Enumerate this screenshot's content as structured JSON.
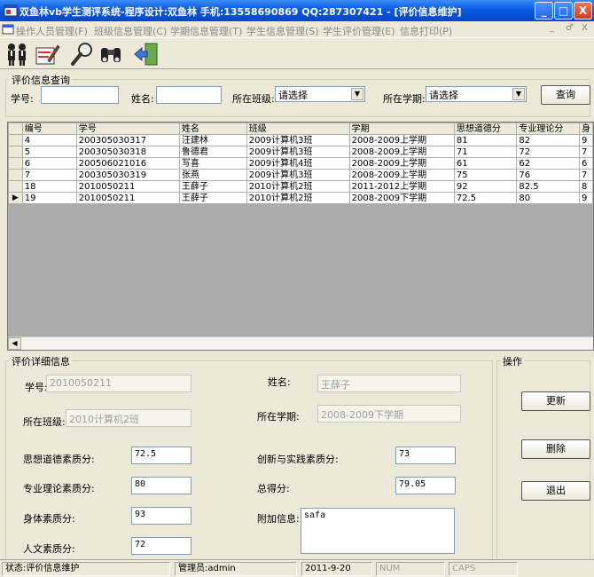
{
  "window": {
    "title": "双鱼林vb学生测评系统-程序设计:双鱼林 手机:13558690869 QQ:287307421 - [评价信息维护]",
    "minimize": "_",
    "maximize": "□",
    "close": "X"
  },
  "menu": {
    "items": [
      "操作人员管理(F)",
      "班级信息管理(C)",
      "学期信息管理(T)",
      "学生信息管理(S)",
      "学生评价管理(E)",
      "信息打印(P)"
    ],
    "mdi_controls": [
      "_",
      "♂",
      "X"
    ]
  },
  "toolbar": {
    "buttons": [
      "users-icon",
      "edit-icon",
      "search-icon",
      "binoculars-icon",
      "exit-icon"
    ]
  },
  "query": {
    "title": "评价信息查询",
    "student_no_label": "学号:",
    "student_no_value": "",
    "name_label": "姓名:",
    "name_value": "",
    "class_label": "所在班级:",
    "class_value": "请选择",
    "term_label": "所在学期:",
    "term_value": "请选择",
    "search_button": "查询"
  },
  "grid": {
    "columns": [
      "编号",
      "学号",
      "姓名",
      "班级",
      "学期",
      "思想道德分",
      "专业理论分",
      "身"
    ],
    "rows": [
      [
        "4",
        "200305030317",
        "汪建林",
        "2009计算机3班",
        "2008-2009上学期",
        "81",
        "82",
        "9"
      ],
      [
        "5",
        "200305030318",
        "鲁德君",
        "2009计算机3班",
        "2008-2009上学期",
        "71",
        "72",
        "7"
      ],
      [
        "6",
        "200506021016",
        "写喜",
        "2009计算机4班",
        "2008-2009上学期",
        "61",
        "62",
        "6"
      ],
      [
        "7",
        "200305030319",
        "张燕",
        "2009计算机3班",
        "2008-2009上学期",
        "75",
        "76",
        "7"
      ],
      [
        "18",
        "2010050211",
        "王薛子",
        "2010计算机2班",
        "2011-2012上学期",
        "92",
        "82.5",
        "8"
      ],
      [
        "19",
        "2010050211",
        "王薛子",
        "2010计算机2班",
        "2008-2009下学期",
        "72.5",
        "80",
        "9"
      ]
    ],
    "current_row_index": 5,
    "current_row_marker": "▶",
    "scroll_left_arrow": "◀"
  },
  "detail": {
    "title": "评价详细信息",
    "student_no_label": "学号:",
    "student_no_value": "2010050211",
    "name_label": "姓名:",
    "name_value": "王薛子",
    "class_label": "所在班级:",
    "class_value": "2010计算机2班",
    "term_label": "所在学期:",
    "term_value": "2008-2009下学期",
    "moral_label": "思想道德素质分:",
    "moral_value": "72.5",
    "innovation_label": "创新与实践素质分:",
    "innovation_value": "73",
    "theory_label": "专业理论素质分:",
    "theory_value": "80",
    "total_label": "总得分:",
    "total_value": "79.05",
    "physical_label": "身体素质分:",
    "physical_value": "93",
    "extra_label": "附加信息:",
    "extra_value": "safa",
    "humanities_label": "人文素质分:",
    "humanities_value": "72"
  },
  "actions": {
    "title": "操作",
    "update": "更新",
    "delete": "删除",
    "exit": "退出"
  },
  "status": {
    "state": "状态:评价信息维护",
    "admin": "管理员:admin",
    "date": "2011-9-20",
    "num": "NUM",
    "caps": "CAPS"
  }
}
